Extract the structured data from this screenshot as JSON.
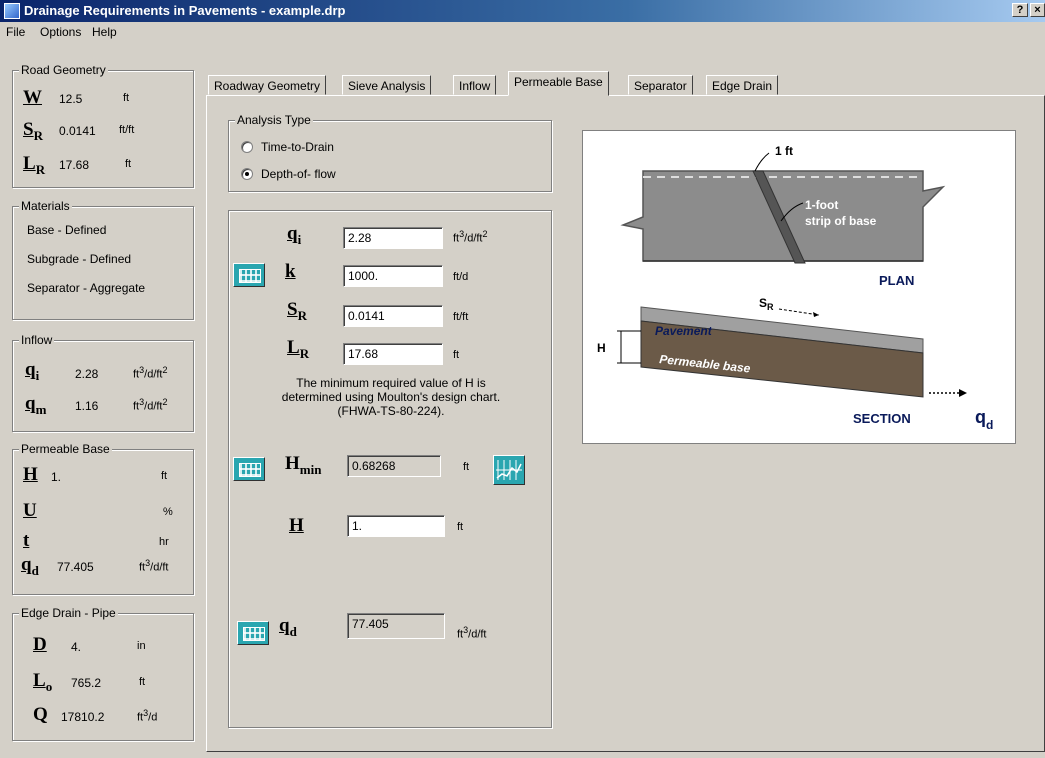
{
  "window": {
    "title": "Drainage Requirements in Pavements - example.drp",
    "help_button": "?",
    "close_button": "×"
  },
  "menu": [
    "File",
    "Options",
    "Help"
  ],
  "sidebar": {
    "road_geometry": {
      "legend": "Road Geometry",
      "W": {
        "sym": "W",
        "value": "12.5",
        "unit": "ft"
      },
      "SR": {
        "sym": "S",
        "sub": "R",
        "value": "0.0141",
        "unit": "ft/ft"
      },
      "LR": {
        "sym": "L",
        "sub": "R",
        "value": "17.68",
        "unit": "ft"
      }
    },
    "materials": {
      "legend": "Materials",
      "items": [
        "Base - Defined",
        "Subgrade - Defined",
        "Separator - Aggregate"
      ]
    },
    "inflow": {
      "legend": "Inflow",
      "qi": {
        "sym": "q",
        "sub": "i",
        "value": "2.28",
        "unit": "ft",
        "unit_sup": "3",
        "unit_mid": "/d/ft",
        "unit_sup2": "2"
      },
      "qm": {
        "sym": "q",
        "sub": "m",
        "value": "1.16",
        "unit": "ft",
        "unit_sup": "3",
        "unit_mid": "/d/ft",
        "unit_sup2": "2"
      }
    },
    "permeable_base": {
      "legend": "Permeable Base",
      "H": {
        "sym": "H",
        "value": "1.",
        "unit": "ft"
      },
      "U": {
        "sym": "U",
        "value": "",
        "unit": "%"
      },
      "t": {
        "sym": "t",
        "value": "",
        "unit": "hr"
      },
      "qd": {
        "sym": "q",
        "sub": "d",
        "value": "77.405",
        "unit": "ft",
        "unit_sup": "3",
        "unit_mid": "/d/ft"
      }
    },
    "edge_drain": {
      "legend": "Edge Drain - Pipe",
      "D": {
        "sym": "D",
        "value": "4.",
        "unit": "in"
      },
      "Lo": {
        "sym": "L",
        "sub": "o",
        "value": "765.2",
        "unit": "ft"
      },
      "Q": {
        "sym": "Q",
        "value": "17810.2",
        "unit": "ft",
        "unit_sup": "3",
        "unit_mid": "/d"
      }
    }
  },
  "tabs": [
    "Roadway Geometry",
    "Sieve Analysis",
    "Inflow",
    "Permeable Base",
    "Separator",
    "Edge Drain"
  ],
  "active_tab": "Permeable Base",
  "analysis_type": {
    "legend": "Analysis Type",
    "options": [
      "Time-to-Drain",
      "Depth-of- flow"
    ],
    "selected": "Depth-of- flow"
  },
  "form": {
    "qi": {
      "sym": "q",
      "sub": "i",
      "value": "2.28",
      "unit": "ft",
      "unit_sup": "3",
      "unit_mid": "/d/ft",
      "unit_sup2": "2"
    },
    "k": {
      "sym": "k",
      "value": "1000.",
      "unit": "ft/d"
    },
    "SR": {
      "sym": "S",
      "sub": "R",
      "value": "0.0141",
      "unit": "ft/ft"
    },
    "LR": {
      "sym": "L",
      "sub": "R",
      "value": "17.68",
      "unit": "ft"
    },
    "note_line1": "The minimum required value of H is",
    "note_line2": "determined using Moulton's design chart.",
    "note_line3": "(FHWA-TS-80-224).",
    "Hmin": {
      "sym": "H",
      "sub": "min",
      "value": "0.68268",
      "unit": "ft"
    },
    "H": {
      "sym": "H",
      "value": "1.",
      "unit": "ft"
    },
    "qd": {
      "sym": "q",
      "sub": "d",
      "value": "77.405",
      "unit": "ft",
      "unit_sup": "3",
      "unit_mid": "/d/ft"
    }
  },
  "diagram": {
    "label_1ft": "1 ft",
    "label_strip1": "1-foot",
    "label_strip2": "strip of base",
    "label_plan": "PLAN",
    "label_sr": "S",
    "label_sr_sub": "R",
    "label_pavement": "Pavement",
    "label_permeable": "Permeable base",
    "label_H": "H",
    "label_section": "SECTION",
    "label_qd": "q",
    "label_qd_sub": "d"
  }
}
